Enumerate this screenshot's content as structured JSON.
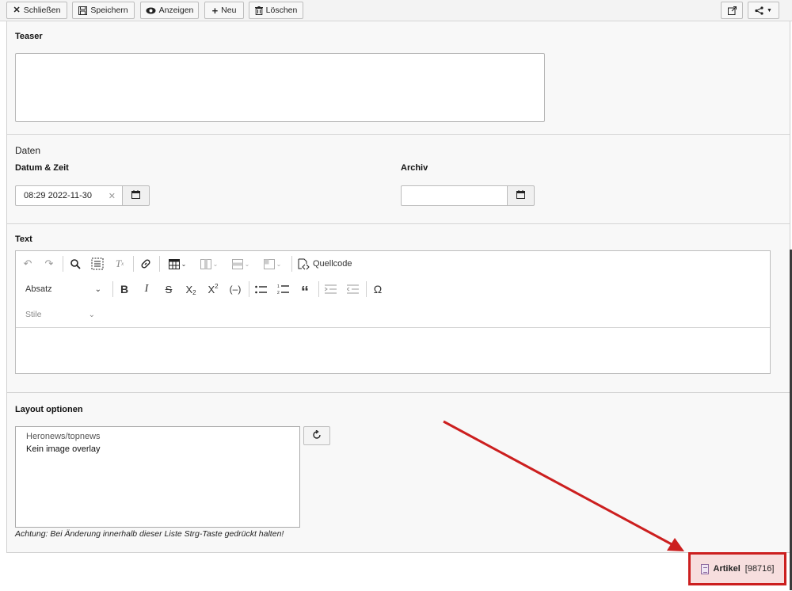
{
  "toolbar": {
    "close_label": "Schließen",
    "save_label": "Speichern",
    "view_label": "Anzeigen",
    "new_label": "Neu",
    "delete_label": "Löschen"
  },
  "teaser": {
    "label": "Teaser",
    "value": ""
  },
  "daten": {
    "legend": "Daten",
    "datetime_label": "Datum & Zeit",
    "datetime_value": "08:29 2022-11-30",
    "archive_label": "Archiv",
    "archive_value": ""
  },
  "text": {
    "label": "Text",
    "source_label": "Quellcode",
    "format_select": "Absatz",
    "styles_select": "Stile",
    "icons": [
      "undo-icon",
      "redo-icon",
      "find-replace-icon",
      "select-all-icon",
      "remove-format-icon",
      "link-icon",
      "table-icon",
      "table-column-icon",
      "table-row-icon",
      "table-cell-icon",
      "source-icon",
      "bold-icon",
      "italic-icon",
      "strikethrough-icon",
      "subscript-icon",
      "superscript-icon",
      "hyphen-icon",
      "bulleted-list-icon",
      "numbered-list-icon",
      "blockquote-icon",
      "indent-icon",
      "outdent-icon",
      "special-char-icon"
    ]
  },
  "layout": {
    "label": "Layout optionen",
    "group": "Heronews/topnews",
    "option": "Kein image overlay",
    "note": "Achtung: Bei Änderung innerhalb dieser Liste Strg-Taste gedrückt halten!"
  },
  "record": {
    "type": "Artikel",
    "id": "[98716]"
  },
  "colors": {
    "highlight": "#cc1f1f"
  }
}
